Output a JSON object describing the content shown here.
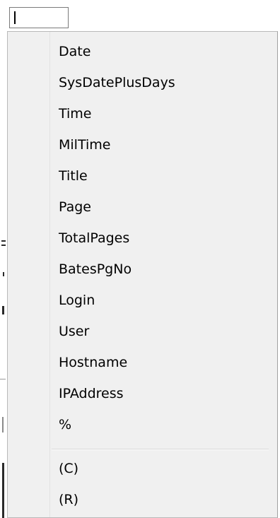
{
  "field": {
    "value": ""
  },
  "menu": {
    "items": [
      {
        "label": "Date"
      },
      {
        "label": "SysDatePlusDays"
      },
      {
        "label": "Time"
      },
      {
        "label": "MilTime"
      },
      {
        "label": "Title"
      },
      {
        "label": "Page"
      },
      {
        "label": "TotalPages"
      },
      {
        "label": "BatesPgNo"
      },
      {
        "label": "Login"
      },
      {
        "label": "User"
      },
      {
        "label": "Hostname"
      },
      {
        "label": "IPAddress"
      },
      {
        "label": "%"
      }
    ],
    "symbols": [
      {
        "label": "(C)"
      },
      {
        "label": "(R)"
      }
    ]
  }
}
